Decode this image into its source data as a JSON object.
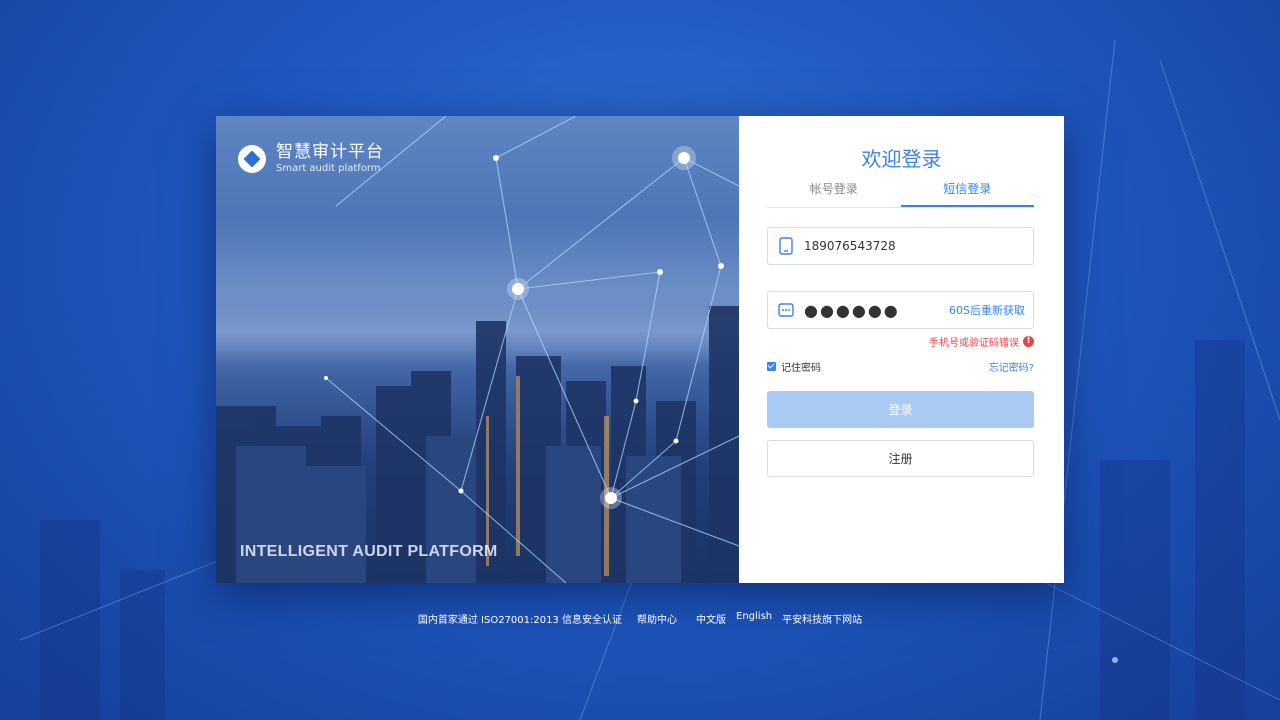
{
  "brand": {
    "name_cn": "智慧审计平台",
    "name_en": "Smart audit platform",
    "logo_icon": "audit-logo-icon"
  },
  "hero": {
    "slogan": "INTELLIGENT AUDIT PLATFORM"
  },
  "login": {
    "title": "欢迎登录",
    "tabs": [
      {
        "label": "帐号登录",
        "active": false
      },
      {
        "label": "短信登录",
        "active": true
      }
    ],
    "phone": {
      "value": "189076543728",
      "icon": "mobile-phone-icon"
    },
    "code": {
      "value": "●●●●●●",
      "icon": "sms-code-icon",
      "resend_label": "60S后重新获取"
    },
    "error": {
      "text": "手机号或验证码错误",
      "icon": "error-icon"
    },
    "remember": {
      "label": "记住密码",
      "checked": true
    },
    "forgot_label": "忘记密码?",
    "login_button": "登录",
    "register_button": "注册"
  },
  "footer": {
    "cert": "国内首家通过 ISO27001:2013 信息安全认证",
    "help": "帮助中心",
    "lang_cn": "中文版",
    "lang_en": "English",
    "site": "平安科技旗下网站"
  },
  "colors": {
    "accent": "#3b82e6",
    "login_disabled": "#a9cbf3",
    "error": "#e64545",
    "background": "#1f58c0"
  }
}
